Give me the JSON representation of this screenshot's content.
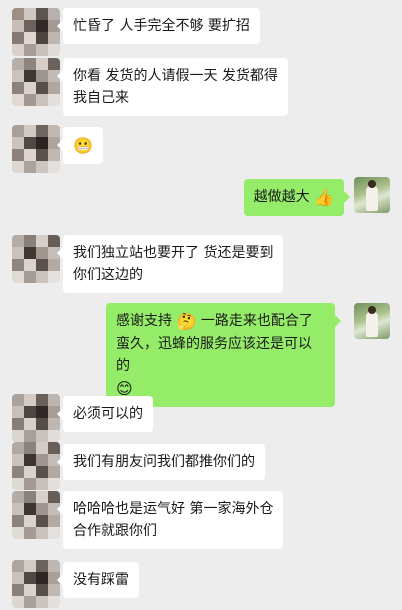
{
  "messages": [
    {
      "side": "left",
      "text": "忙昏了 人手完全不够 要扩招"
    },
    {
      "side": "left",
      "text": "你看 发货的人请假一天 发货都得\n我自己来"
    },
    {
      "side": "left",
      "emoji": "😬"
    },
    {
      "side": "right",
      "text": "越做越大",
      "emoji": "👍"
    },
    {
      "side": "left",
      "text": "我们独立站也要开了 货还是要到\n你们这边的"
    },
    {
      "side": "right",
      "text_a": "感谢支持",
      "emoji_a": "🤔",
      "text_b": "一路走来也配合了\n蛮久，迅蜂的服务应该还是可以的",
      "emoji_b": "😊"
    },
    {
      "side": "left",
      "text": "必须可以的"
    },
    {
      "side": "left",
      "text": "我们有朋友问我们都推你们的"
    },
    {
      "side": "left",
      "text": "哈哈哈也是运气好 第一家海外仓\n合作就跟你们"
    },
    {
      "side": "left",
      "text": "没有踩雷"
    }
  ],
  "colors": {
    "background": "#ededed",
    "incoming": "#ffffff",
    "outgoing": "#95ec69"
  }
}
